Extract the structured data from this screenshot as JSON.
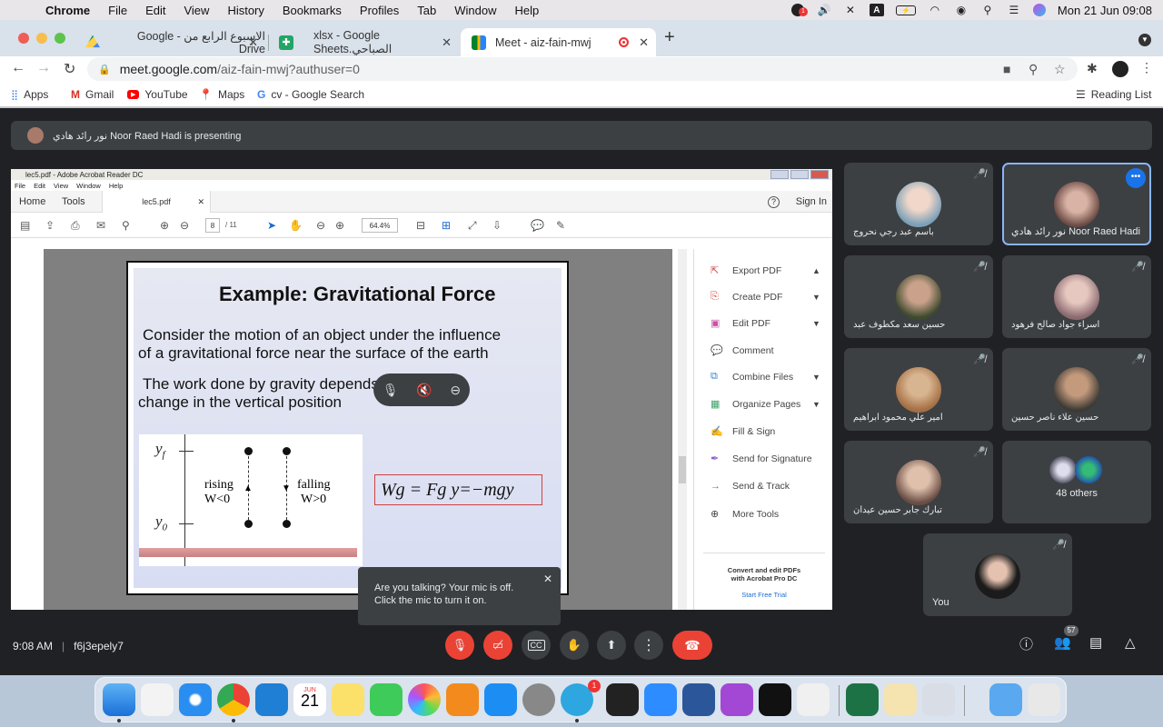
{
  "menubar": {
    "app": "Chrome",
    "items": [
      "File",
      "Edit",
      "View",
      "History",
      "Bookmarks",
      "Profiles",
      "Tab",
      "Window",
      "Help"
    ],
    "datetime": "Mon 21 Jun  09:08",
    "notif_count": "1"
  },
  "tabs": [
    {
      "label": "الاسبوع الرابع من - Google Drive"
    },
    {
      "label": "xlsx - Google Sheets.الصباحي"
    },
    {
      "label": "Meet - aiz-fain-mwj"
    }
  ],
  "omnibox": {
    "url_main": "meet.google.com",
    "url_rest": "/aiz-fain-mwj?authuser=0"
  },
  "bookmarks": {
    "items": [
      "Apps",
      "Gmail",
      "YouTube",
      "Maps",
      "cv - Google Search"
    ],
    "reading_list": "Reading List"
  },
  "presenting": {
    "text": "نور رائد هادي Noor Raed Hadi is presenting"
  },
  "acrobat": {
    "title": "lec5.pdf - Adobe Acrobat Reader DC",
    "menu": [
      "File",
      "Edit",
      "View",
      "Window",
      "Help"
    ],
    "home": "Home",
    "tools": "Tools",
    "doc_tab": "lec5.pdf",
    "sign_in": "Sign In",
    "page_current": "8",
    "page_total": "/ 11",
    "zoom": "64.4%",
    "panel": [
      "Export PDF",
      "Create PDF",
      "Edit PDF",
      "Comment",
      "Combine Files",
      "Organize Pages",
      "Fill & Sign",
      "Send for Signature",
      "Send & Track",
      "More Tools"
    ],
    "promo_line1": "Convert and edit PDFs",
    "promo_line2": "with Acrobat Pro DC",
    "promo_link": "Start Free Trial"
  },
  "slide": {
    "title": "Example: Gravitational Force",
    "p1_l1": "Consider the motion of an object under the influence",
    "p1_l2": "of a gravitational force near the surface of the earth",
    "p2_l1": "The work done by gravity depends only on the",
    "p2_l2": "change in the vertical position",
    "yf": "y",
    "yf_sub": "f",
    "y0": "y",
    "y0_sub": "0",
    "rising": "rising",
    "rising_w": "W<0",
    "falling": "falling",
    "falling_w": "W>0",
    "formula": "Wg = Fg y=−mgy"
  },
  "participants": [
    {
      "name": "باسم عبد رجي نحروج"
    },
    {
      "name": "نور رائد هادي Noor Raed Hadi"
    },
    {
      "name": "حسين سعد مكطوف عبد"
    },
    {
      "name": "اسراء جواد صالح فرهود"
    },
    {
      "name": "امير علي محمود ابراهيم"
    },
    {
      "name": "حسين علاء ناصر حسين"
    },
    {
      "name": "تبارك جابر حسين عيدان"
    },
    {
      "name": "48 others"
    },
    {
      "name": "You"
    }
  ],
  "tooltip": {
    "line1": "Are you talking? Your mic is off.",
    "line2": "Click the mic to turn it on."
  },
  "meeting": {
    "time": "9:08 AM",
    "code": "f6j3epely7",
    "people_count": "57"
  },
  "dock": {
    "calendar_month": "JUN",
    "calendar_day": "21",
    "badge": "1"
  }
}
